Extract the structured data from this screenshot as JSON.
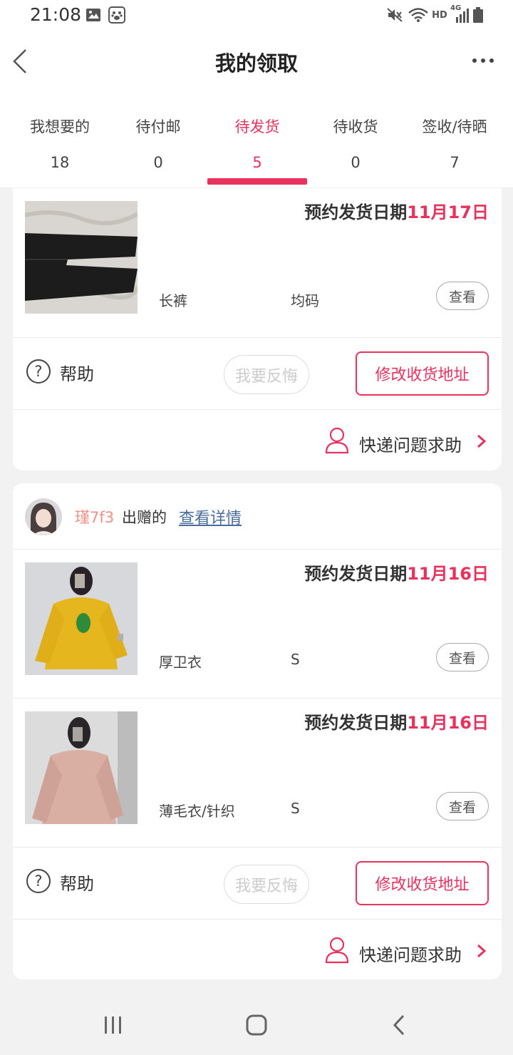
{
  "status_bar": {
    "time": "21:08",
    "network_label": "HD",
    "network_type": "4G",
    "icons": [
      "gallery-icon",
      "baidu-paw-icon",
      "mute-icon",
      "wifi-icon",
      "signal-icon",
      "battery-icon"
    ]
  },
  "header": {
    "title": "我的领取",
    "back_icon": "chevron-left-icon",
    "more_icon": "more-dots-icon"
  },
  "tabs": [
    {
      "label": "我想要的",
      "count": "18",
      "active": false
    },
    {
      "label": "待付邮",
      "count": "0",
      "active": false
    },
    {
      "label": "待发货",
      "count": "5",
      "active": true
    },
    {
      "label": "待收货",
      "count": "0",
      "active": false
    },
    {
      "label": "签收/待晒",
      "count": "7",
      "active": false
    }
  ],
  "colors": {
    "accent": "#e8325d",
    "link": "#4a6c9a",
    "username": "#f0908a",
    "background": "#f2f2f2"
  },
  "orders": [
    {
      "items": [
        {
          "ship_prefix": "预约发货日期",
          "ship_date": "11月17日",
          "name": "长裤",
          "size": "均码",
          "view_label": "查看",
          "image": "black-trousers-photo"
        }
      ],
      "help_label": "帮助",
      "regret_label": "我要反悔",
      "address_label": "修改收货地址",
      "courier_label": "快递问题求助"
    },
    {
      "giver": {
        "username": "瑾7f3",
        "gave_label": "出赠的",
        "detail_link": "查看详情"
      },
      "items": [
        {
          "ship_prefix": "预约发货日期",
          "ship_date": "11月16日",
          "name": "厚卫衣",
          "size": "S",
          "view_label": "查看",
          "image": "yellow-hoodie-photo"
        },
        {
          "ship_prefix": "预约发货日期",
          "ship_date": "11月16日",
          "name": "薄毛衣/针织",
          "size": "S",
          "view_label": "查看",
          "image": "pink-sweater-photo"
        }
      ],
      "help_label": "帮助",
      "regret_label": "我要反悔",
      "address_label": "修改收货地址",
      "courier_label": "快递问题求助"
    }
  ],
  "nav": {
    "icons": [
      "recent-apps-icon",
      "home-icon",
      "back-icon"
    ]
  }
}
